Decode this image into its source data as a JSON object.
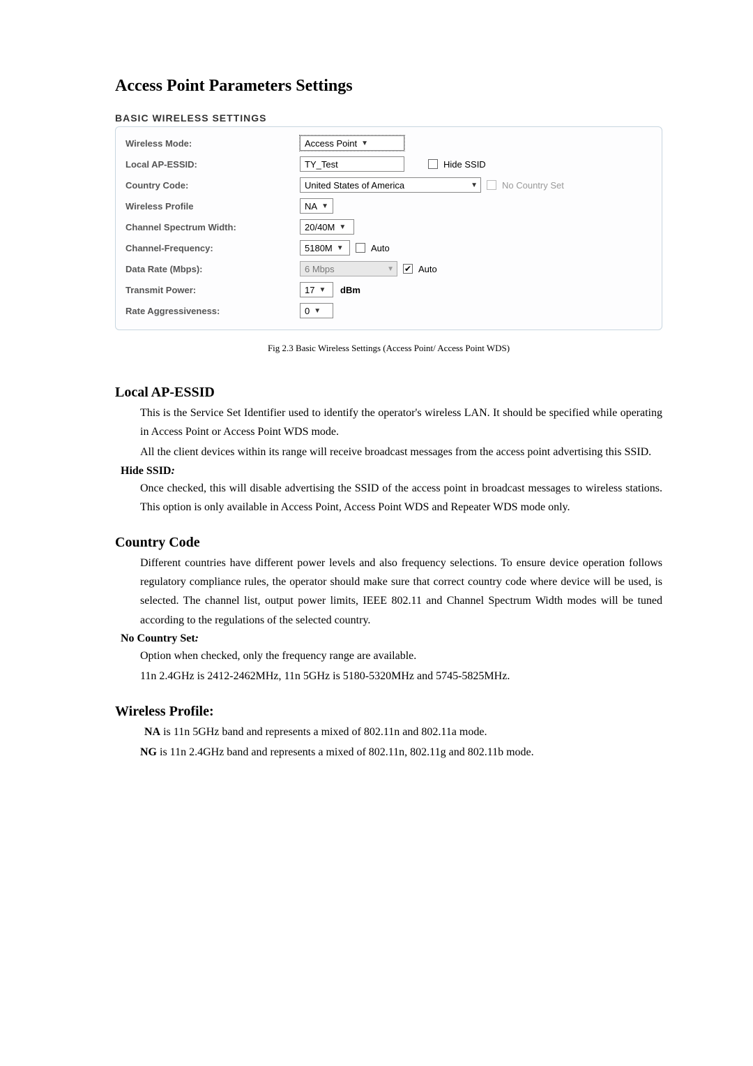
{
  "page_title": "Access Point Parameters Settings",
  "panel_title": "BASIC WIRELESS SETTINGS",
  "rows": {
    "wireless_mode": {
      "label": "Wireless Mode:",
      "value": "Access Point"
    },
    "local_ap_essid": {
      "label": "Local AP-ESSID:",
      "value": "TY_Test",
      "hide_label": "Hide SSID"
    },
    "country_code": {
      "label": "Country Code:",
      "value": "United States of America",
      "noc_label": "No Country Set"
    },
    "wireless_profile": {
      "label": "Wireless Profile",
      "value": "NA"
    },
    "csw": {
      "label": "Channel Spectrum Width:",
      "value": "20/40M"
    },
    "chfreq": {
      "label": "Channel-Frequency:",
      "value": "5180M",
      "auto_label": "Auto"
    },
    "datarate": {
      "label": "Data Rate (Mbps):",
      "value": "6 Mbps",
      "auto_label": "Auto"
    },
    "txpower": {
      "label": "Transmit Power:",
      "value": "17",
      "unit": "dBm"
    },
    "rateagg": {
      "label": "Rate Aggressiveness:",
      "value": "0"
    }
  },
  "caption": "Fig 2.3 Basic Wireless Settings (Access Point/ Access Point WDS)",
  "sections": {
    "local_ap_essid": {
      "title": "Local AP-ESSID",
      "p1": "This is the Service Set Identifier used to identify the operator's wireless LAN. It should be  specified while operating in Access Point or Access Point WDS mode.",
      "p2": "All the client devices within its range will receive broadcast messages from the access    point advertising this SSID.",
      "sub_title": "Hide SSID",
      "sub_body": "Once checked, this will disable advertising the SSID of the access point in broadcast messages to wireless stations. This option is only available in Access Point, Access Point WDS and Repeater WDS mode only."
    },
    "country_code": {
      "title": "Country Code",
      "p1": "Different countries have different power levels and also frequency selections. To ensure device operation follows regulatory compliance rules, the operator should make sure   that correct country code where device will be used, is selected. The channel list, output  power limits, IEEE 802.11 and Channel Spectrum Width modes will be tuned according to the regulations of the selected country.",
      "sub_title": "No Country Set",
      "sub_p1": "Option when checked, only the frequency range are available.",
      "sub_p2": "11n 2.4GHz is 2412-2462MHz, 11n 5GHz is 5180-5320MHz and 5745-5825MHz."
    },
    "wireless_profile": {
      "title": "Wireless Profile:",
      "p1a": "NA",
      "p1b": " is 11n 5GHz band and represents a mixed of 802.11n and 802.11a mode.",
      "p2a": "NG",
      "p2b": " is 11n 2.4GHz band and represents a mixed of 802.11n, 802.11g and 802.11b mode."
    }
  }
}
